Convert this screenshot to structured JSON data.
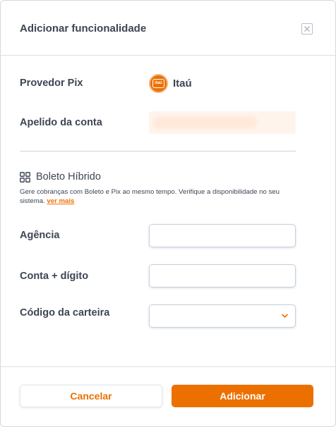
{
  "modal": {
    "title": "Adicionar funcionalidade"
  },
  "provider": {
    "label": "Provedor Pix",
    "bank_name": "Itaú",
    "logo_text": "itaú",
    "logo_icon": "itau-logo",
    "brand_color": "#ec7000"
  },
  "nickname": {
    "label": "Apelido da conta"
  },
  "boleto": {
    "title": "Boleto Híbrido",
    "icon": "grid-icon",
    "description": "Gere cobranças com Boleto e Pix ao mesmo tempo. Verifique a disponibilidade no seu sistema.",
    "link": "ver mais"
  },
  "fields": {
    "agencia_label": "Agência",
    "conta_label": "Conta + dígito",
    "carteira_label": "Código da carteira"
  },
  "footer": {
    "cancel_label": "Cancelar",
    "add_label": "Adicionar"
  }
}
